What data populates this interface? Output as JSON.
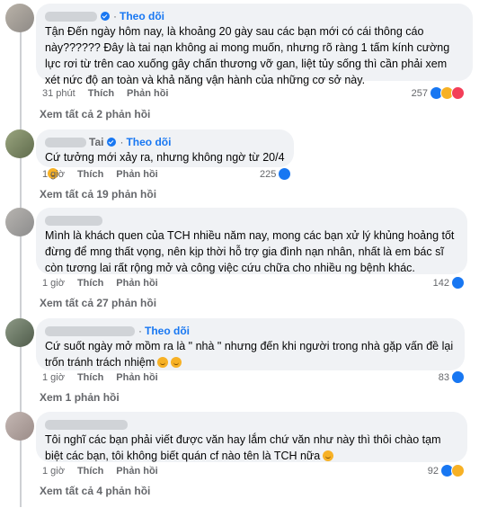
{
  "common": {
    "follow": "Theo dõi",
    "like": "Thích",
    "reply": "Phản hồi",
    "dot": "·"
  },
  "comments": [
    {
      "name_partial": "",
      "text": "Tận Đến ngày hôm nay, là khoảng 20 gày sau các bạn mới có cái thông cáo này?????? Đây là tai nạn không ai mong muốn, nhưng rõ ràng 1 tấm kính cường lực rơi từ trên cao xuống gây chấn thương vỡ gan, liệt tủy sống thì cần phải xem xét nức độ an toàn và khả năng vận hành của những cơ sở này.",
      "time": "31 phút",
      "reactions": "257",
      "view_more": "Xem tất cả 2 phản hồi"
    },
    {
      "name_partial": "Tai",
      "text": "Cứ tưởng mới xảy ra, nhưng không ngờ từ 20/4",
      "time": "1 giờ",
      "reactions": "225",
      "view_more": "Xem tất cả 19 phản hồi"
    },
    {
      "name_partial": "",
      "text": "Mình là khách quen của TCH nhiều năm nay, mong các bạn xử lý khủng hoảng tốt đừng để mng thất vọng, nên kịp thời hỗ trợ gia đình nạn nhân, nhất là em bác sĩ còn tương lai rất rộng mở và công việc cứu chữa cho nhiều ng bệnh khác.",
      "time": "1 giờ",
      "reactions": "142",
      "view_more": "Xem tất cả 27 phản hồi"
    },
    {
      "name_partial": "",
      "text": "Cứ suốt ngày mở mồm ra là \" nhà \" nhưng đến khi người trong nhà gặp vấn đề lại trốn tránh trách nhiệm",
      "time": "1 giờ",
      "reactions": "83",
      "view_more": "Xem 1 phản hồi"
    },
    {
      "name_partial": "",
      "text": "Tôi nghĩ các bạn phải viết được văn hay lắm chứ văn như này thì thôi chào tạm biệt các bạn, tôi không biết quán cf nào tên là TCH nữa",
      "time": "1 giờ",
      "reactions": "92",
      "view_more": "Xem tất cả 4 phản hồi"
    }
  ]
}
